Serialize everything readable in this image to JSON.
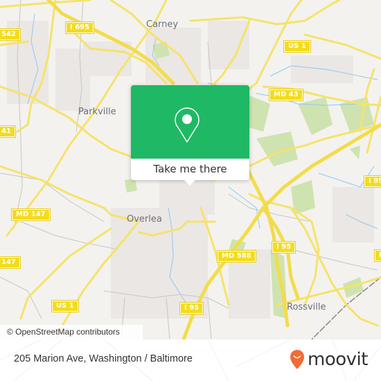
{
  "map": {
    "places": [
      {
        "name": "Carney"
      },
      {
        "name": "Parkville"
      },
      {
        "name": "Overlea"
      },
      {
        "name": "Rossville"
      }
    ],
    "shields": [
      {
        "label": "I 695"
      },
      {
        "label": "542"
      },
      {
        "label": "41"
      },
      {
        "label": "US 1"
      },
      {
        "label": "MD 43"
      },
      {
        "label": "I 95"
      },
      {
        "label": "MD 147"
      },
      {
        "label": "147"
      },
      {
        "label": "MD 588"
      },
      {
        "label": "I 95"
      },
      {
        "label": "US 1"
      },
      {
        "label": "I 95"
      },
      {
        "label": "M"
      }
    ],
    "attribution": "© OpenStreetMap contributors"
  },
  "popup": {
    "icon": "location-pin-icon",
    "action_label": "Take me there",
    "color": "#1fb865"
  },
  "footer": {
    "address": "205 Marion Ave, Washington / Baltimore",
    "brand": "moovit",
    "brand_color": "#f26a36"
  }
}
